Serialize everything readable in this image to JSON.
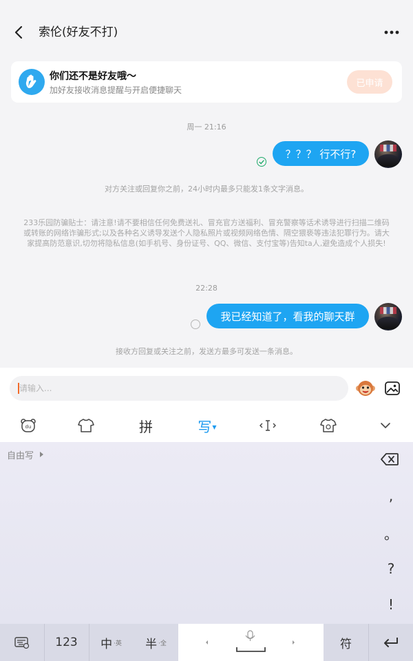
{
  "header": {
    "title": "索伦(好友不打)"
  },
  "friend_card": {
    "title": "你们还不是好友哦～",
    "subtitle": "加好友接收消息提醒与开启便捷聊天",
    "button_label": "已申请"
  },
  "messages": {
    "time_1": "周一 21:16",
    "msg_1": "？？？ 行不行?",
    "system_1": "对方关注或回复你之前，24小时内最多只能发1条文字消息。",
    "system_2": "233乐园防骗贴士：请注意!请不要相信任何免费送礼、冒充官方送福利、冒充警察等话术诱导进行扫描二维码或转账的网络诈骗形式;以及各种名义诱导发送个人隐私照片或视频网络色情、隔空猥亵等违法犯罪行为。请大家提高防范意识,切勿将隐私信息(如手机号、身份证号、QQ、微信、支付宝等)告知ta人,避免造成个人损失!",
    "time_2": "22:28",
    "msg_2": "我已经知道了，看我的聊天群",
    "system_3": "接收方回复或关注之前，发送方最多可发送一条消息。"
  },
  "input": {
    "placeholder": "请输入..."
  },
  "ime": {
    "toolbar": {
      "pinyin_label": "拼",
      "write_label": "写"
    },
    "free_write_label": "自由写",
    "punctuation": [
      ",",
      "。",
      "?",
      "!"
    ],
    "keys": {
      "num_label": "123",
      "zh_label": "中",
      "zh_sub": "·英",
      "half_label": "半",
      "half_sub": "·全",
      "symbol_label": "符"
    }
  },
  "colors": {
    "accent": "#1ea5f2",
    "applied_button": "#fde1d4",
    "background": "#f4f4f6",
    "sent_check": "#1faa6a"
  }
}
